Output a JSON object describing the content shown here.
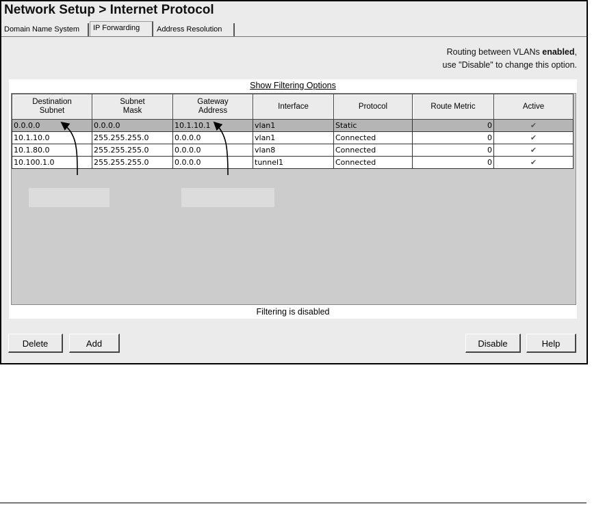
{
  "title": "Network Setup > Internet Protocol",
  "tabs": [
    {
      "label": "Domain Name System"
    },
    {
      "label": "IP Forwarding"
    },
    {
      "label": "Address Resolution"
    }
  ],
  "routing": {
    "line1_prefix": "Routing between VLANs ",
    "line1_status": "enabled",
    "line1_suffix": ",",
    "line2": "use \"Disable\" to change this option."
  },
  "filter_link": "Show Filtering Options",
  "table": {
    "columns": [
      [
        "Destination",
        "Subnet"
      ],
      [
        "Subnet",
        "Mask"
      ],
      [
        "Gateway",
        "Address"
      ],
      [
        "Interface"
      ],
      [
        "Protocol"
      ],
      [
        "Route Metric"
      ],
      [
        "Active"
      ]
    ],
    "rows": [
      {
        "dest": "0.0.0.0",
        "mask": "0.0.0.0",
        "gateway": "10.1.10.1",
        "iface": "vlan1",
        "protocol": "Static",
        "metric": "0",
        "active": "✔"
      },
      {
        "dest": "10.1.10.0",
        "mask": "255.255.255.0",
        "gateway": "0.0.0.0",
        "iface": "vlan1",
        "protocol": "Connected",
        "metric": "0",
        "active": "✔"
      },
      {
        "dest": "10.1.80.0",
        "mask": "255.255.255.0",
        "gateway": "0.0.0.0",
        "iface": "vlan8",
        "protocol": "Connected",
        "metric": "0",
        "active": "✔"
      },
      {
        "dest": "10.100.1.0",
        "mask": "255.255.255.0",
        "gateway": "0.0.0.0",
        "iface": "tunnel1",
        "protocol": "Connected",
        "metric": "0",
        "active": "✔"
      }
    ]
  },
  "filter_status": "Filtering is disabled",
  "buttons": {
    "delete": "Delete",
    "add": "Add",
    "disable": "Disable",
    "help": "Help"
  },
  "icons": {
    "check": "checkmark-icon"
  }
}
